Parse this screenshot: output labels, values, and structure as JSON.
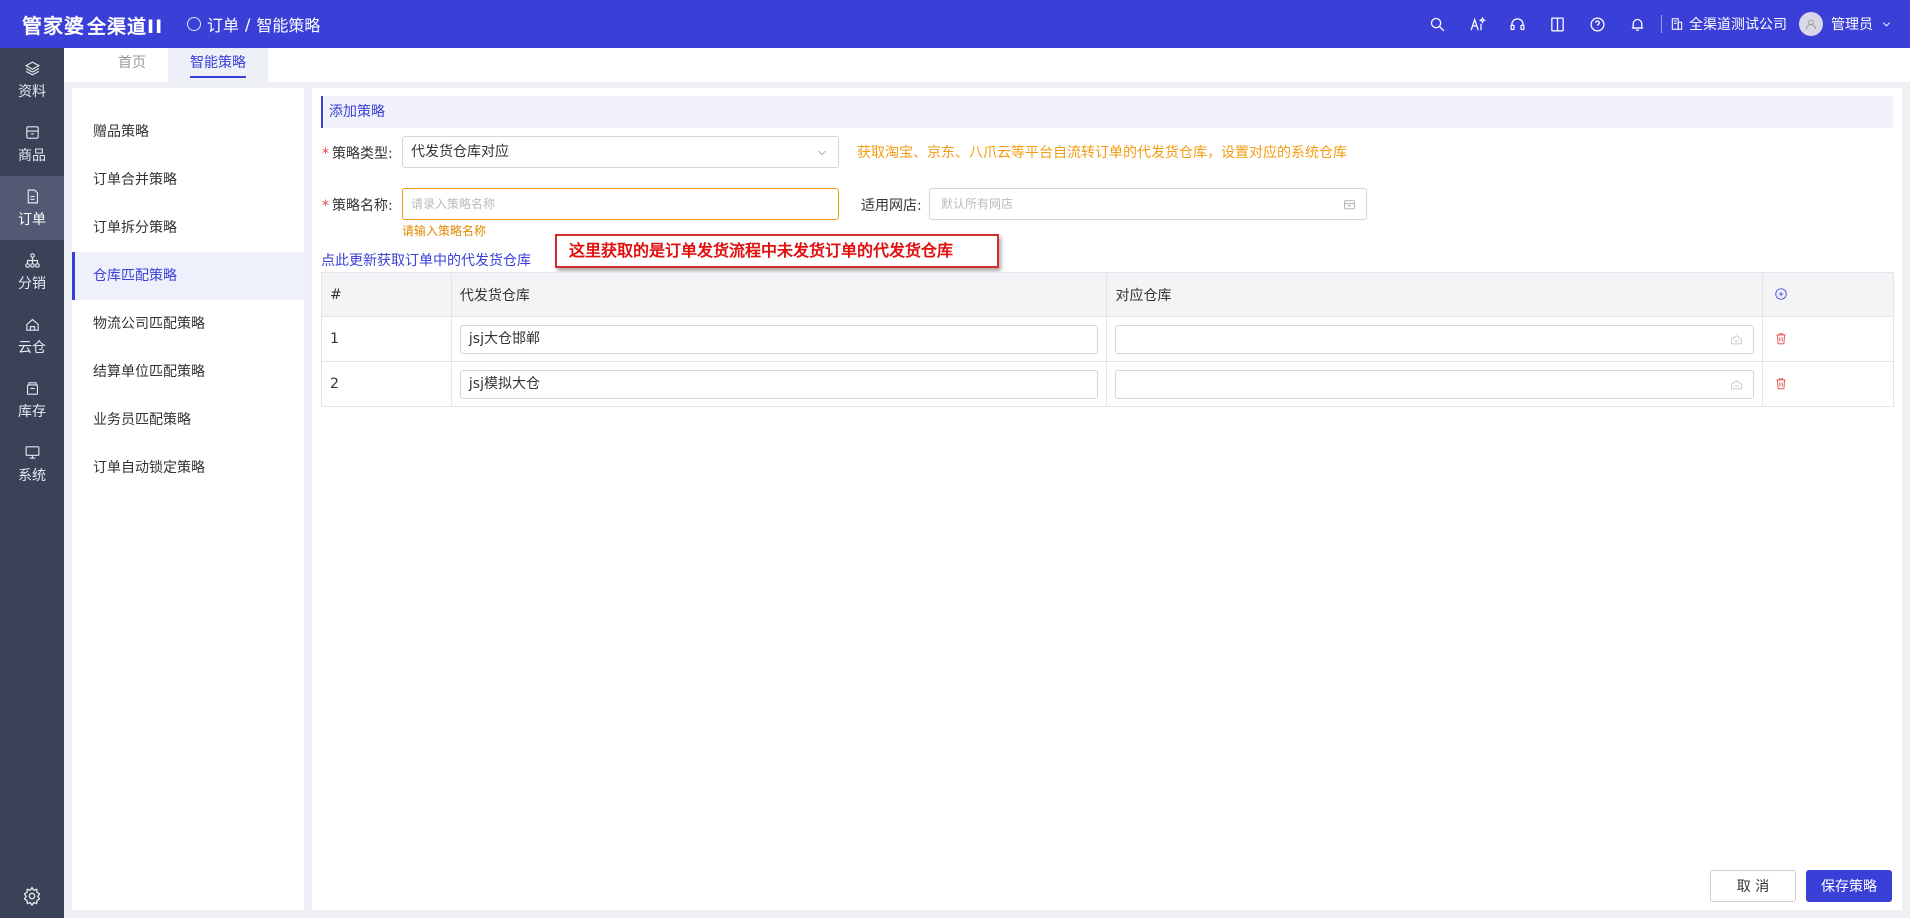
{
  "header": {
    "logo_main": "管家婆",
    "logo_sub": "全渠道II",
    "breadcrumb_module": "订单",
    "breadcrumb_separator": "/",
    "breadcrumb_page": "智能策略",
    "icons": [
      "search-icon",
      "ai-icon",
      "headset-icon",
      "book-icon",
      "help-icon",
      "bell-icon"
    ],
    "company": "全渠道测试公司",
    "user": "管理员"
  },
  "leftnav": {
    "items": [
      {
        "label": "资料",
        "icon": "layers-icon"
      },
      {
        "label": "商品",
        "icon": "box-icon"
      },
      {
        "label": "订单",
        "icon": "document-icon",
        "active": true
      },
      {
        "label": "分销",
        "icon": "network-icon"
      },
      {
        "label": "云仓",
        "icon": "cloud-house-icon"
      },
      {
        "label": "库存",
        "icon": "stack-icon"
      },
      {
        "label": "系统",
        "icon": "monitor-icon"
      }
    ],
    "settings_icon": "gear-icon"
  },
  "tabs": [
    {
      "label": "首页",
      "active": false
    },
    {
      "label": "智能策略",
      "active": true
    }
  ],
  "sidemenu": {
    "items": [
      "赠品策略",
      "订单合并策略",
      "订单拆分策略",
      "仓库匹配策略",
      "物流公司匹配策略",
      "结算单位匹配策略",
      "业务员匹配策略",
      "订单自动锁定策略"
    ],
    "active_index": 3
  },
  "form": {
    "section_title": "添加策略",
    "strategy_type_label": "策略类型:",
    "strategy_type_value": "代发货仓库对应",
    "strategy_type_hint": "获取淘宝、京东、八爪云等平台自流转订单的代发货仓库，设置对应的系统仓库",
    "strategy_name_label": "策略名称:",
    "strategy_name_placeholder": "请录入策略名称",
    "strategy_name_error": "请输入策略名称",
    "shop_label": "适用网店:",
    "shop_placeholder": "默认所有网店",
    "refresh_link": "点此更新获取订单中的代发货仓库",
    "callout": "这里获取的是订单发货流程中未发货订单的代发货仓库"
  },
  "table": {
    "headers": [
      "#",
      "代发货仓库",
      "对应仓库"
    ],
    "rows": [
      {
        "no": "1",
        "dropship_warehouse": "jsj大仓邯郸",
        "mapped_warehouse": ""
      },
      {
        "no": "2",
        "dropship_warehouse": "jsj模拟大仓",
        "mapped_warehouse": ""
      }
    ]
  },
  "actions": {
    "cancel": "取 消",
    "save": "保存策略"
  },
  "colors": {
    "primary": "#3a3fd8",
    "nav_bg": "#3b4257",
    "warning": "#f39c12",
    "danger": "#e64545"
  }
}
